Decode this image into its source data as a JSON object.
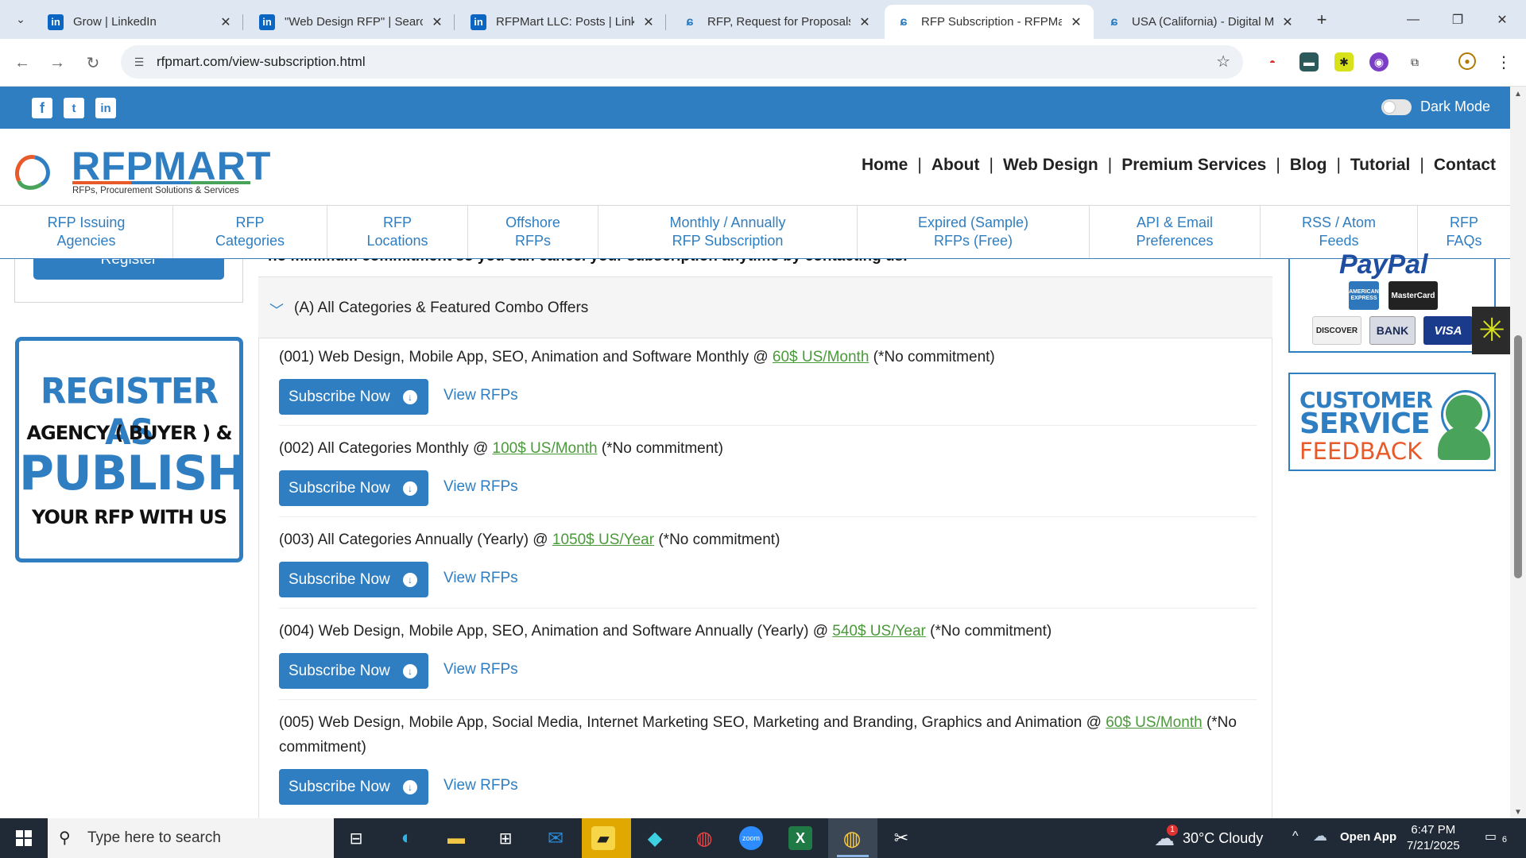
{
  "browser": {
    "tabs": [
      {
        "title": "Grow | LinkedIn",
        "icon": "linkedin-icon"
      },
      {
        "title": "\"Web Design RFP\" | Search",
        "icon": "linkedin-icon"
      },
      {
        "title": "RFPMart LLC: Posts | LinkedIn",
        "icon": "linkedin-icon"
      },
      {
        "title": "RFP, Request for Proposals",
        "icon": "rfpmart-icon"
      },
      {
        "title": "RFP Subscription - RFPMart",
        "icon": "rfpmart-icon",
        "active": true
      },
      {
        "title": "USA (California) - Digital M",
        "icon": "rfpmart-icon"
      }
    ],
    "url": "rfpmart.com/view-subscription.html"
  },
  "site": {
    "dark_mode_label": "Dark Mode",
    "logo_text": "RFPMART",
    "logo_tagline": "RFPs, Procurement Solutions & Services",
    "main_nav": [
      "Home",
      "About",
      "Web Design",
      "Premium Services",
      "Blog",
      "Tutorial",
      "Contact"
    ],
    "category_nav": [
      "RFP Issuing\nAgencies",
      "RFP\nCategories",
      "RFP\nLocations",
      "Offshore\nRFPs",
      "Monthly / Annually\nRFP Subscription",
      "Expired (Sample)\nRFPs (Free)",
      "API & Email\nPreferences",
      "RSS / Atom\nFeeds",
      "RFP\nFAQs"
    ],
    "register_button": "Register",
    "register_banner": {
      "line1": "REGISTER AS",
      "line2": "AGENCY ( BUYER ) &",
      "line3": "PUBLISH",
      "line4": "YOUR RFP WITH US"
    },
    "cut_text": "no minimum commitment so you can cancel your subscription anytime by contacting us.",
    "accordion_title": "(A) All Categories & Featured Combo Offers",
    "subscribe_label": "Subscribe Now",
    "view_label": "View RFPs",
    "offers": [
      {
        "text": "(001) Web Design, Mobile App, SEO, Animation and Software Monthly @ ",
        "price": "60$ US/Month",
        "suffix": " (*No commitment)"
      },
      {
        "text": "(002) All Categories Monthly @ ",
        "price": "100$ US/Month",
        "suffix": " (*No commitment)"
      },
      {
        "text": "(003) All Categories Annually (Yearly) @ ",
        "price": "1050$ US/Year",
        "suffix": " (*No commitment)"
      },
      {
        "text": "(004) Web Design, Mobile App, SEO, Animation and Software Annually (Yearly) @ ",
        "price": "540$ US/Year",
        "suffix": " (*No commitment)"
      },
      {
        "text": "(005) Web Design, Mobile App, Social Media, Internet Marketing SEO, Marketing and Branding, Graphics and Animation @ ",
        "price": "60$ US/Month",
        "suffix": " (*No commitment)"
      }
    ],
    "payment": {
      "paypal": "PayPal",
      "cards": [
        "AMERICAN EXPRESS",
        "MasterCard",
        "DISCOVER",
        "BANK",
        "VISA"
      ]
    },
    "feedback": {
      "line1": "CUSTOMER",
      "line2": "SERVICE",
      "line3": "FEEDBACK"
    }
  },
  "taskbar": {
    "search_placeholder": "Type here to search",
    "weather": "30°C  Cloudy",
    "weather_badge": "1",
    "open_app": "Open App",
    "time": "6:47 PM",
    "date": "7/21/2025",
    "notification_count": "6"
  },
  "colors": {
    "brand": "#2f7ec1",
    "price": "#4a9a3a",
    "accent_orange": "#e85a2a"
  }
}
